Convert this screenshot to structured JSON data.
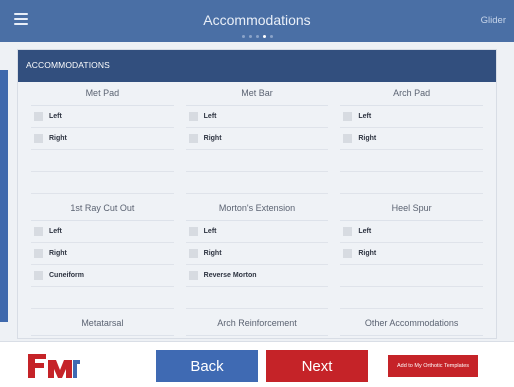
{
  "header": {
    "title": "Accommodations",
    "right_label": "Glider"
  },
  "panel": {
    "title": "ACCOMMODATIONS"
  },
  "sections": [
    {
      "columns": [
        {
          "title": "Met Pad",
          "options": [
            "Left",
            "Right"
          ]
        },
        {
          "title": "Met Bar",
          "options": [
            "Left",
            "Right"
          ]
        },
        {
          "title": "Arch Pad",
          "options": [
            "Left",
            "Right"
          ]
        }
      ]
    },
    {
      "columns": [
        {
          "title": "1st Ray Cut Out",
          "options": [
            "Left",
            "Right",
            "Cuneiform"
          ]
        },
        {
          "title": "Morton's Extension",
          "options": [
            "Left",
            "Right",
            "Reverse Morton"
          ]
        },
        {
          "title": "Heel Spur",
          "options": [
            "Left",
            "Right"
          ]
        }
      ]
    },
    {
      "columns": [
        {
          "title": "Metatarsal",
          "options": []
        },
        {
          "title": "Arch Reinforcement",
          "options": []
        },
        {
          "title": "Other Accommodations",
          "options": []
        }
      ]
    }
  ],
  "footer": {
    "back_label": "Back",
    "next_label": "Next",
    "add_template_label": "Add to My Orthotic Templates",
    "logo_text": "FMR"
  },
  "colors": {
    "header": "#4a6fa5",
    "panel_header": "#324f7e",
    "back": "#3f6ab3",
    "next": "#c52328"
  }
}
